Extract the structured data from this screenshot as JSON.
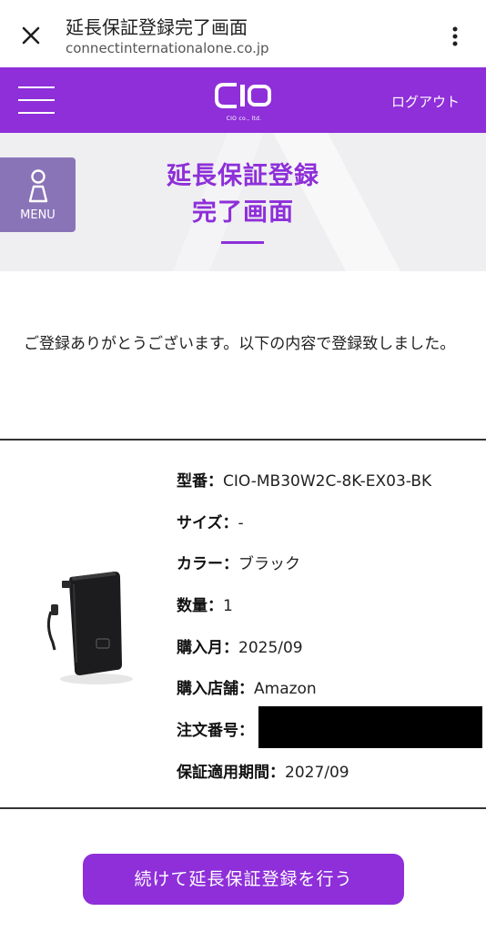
{
  "browser": {
    "title": "延長保証登録完了画面",
    "url": "connectinternationalone.co.jp"
  },
  "header": {
    "logo_text": "CIO",
    "logo_sub": "CIO co., ltd.",
    "logout_label": "ログアウト"
  },
  "hero": {
    "menu_label": "MENU",
    "title_line1": "延長保証登録",
    "title_line2": "完了画面"
  },
  "message": "ご登録ありがとうございます。以下の内容で登録致しました。",
  "details": [
    {
      "key": "型番：",
      "value": "CIO-MB30W2C-8K-EX03-BK"
    },
    {
      "key": "サイズ：",
      "value": "-"
    },
    {
      "key": "カラー：",
      "value": "ブラック"
    },
    {
      "key": "数量：",
      "value": "1"
    },
    {
      "key": "購入月：",
      "value": "2025/09"
    },
    {
      "key": "購入店舗：",
      "value": "Amazon"
    },
    {
      "key": "注文番号：",
      "value": ""
    },
    {
      "key": "保証適用期間：",
      "value": "2027/09"
    }
  ],
  "cta_label": "続けて延長保証登録を行う",
  "colors": {
    "brand_purple": "#8e2fd9",
    "menu_tab": "#8a74b8",
    "hero_bg": "#efeff1"
  }
}
